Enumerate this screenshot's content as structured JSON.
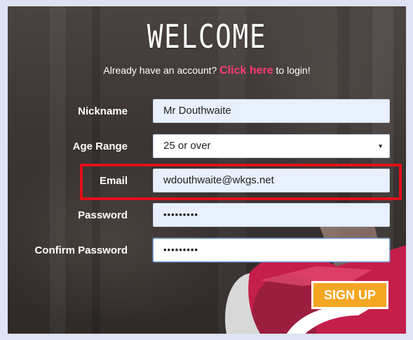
{
  "header": {
    "title": "WELCOME",
    "login_prompt": "Already have an account?",
    "login_link": "Click here",
    "login_suffix": "to login!"
  },
  "form": {
    "nickname": {
      "label": "Nickname",
      "value": "Mr Douthwaite"
    },
    "age_range": {
      "label": "Age Range",
      "value": "25 or over"
    },
    "email": {
      "label": "Email",
      "value": "wdouthwaite@wkgs.net"
    },
    "password": {
      "label": "Password",
      "value": "•••••••••"
    },
    "confirm_password": {
      "label": "Confirm Password",
      "value": "•••••••••"
    }
  },
  "actions": {
    "signup_label": "SIGN UP"
  },
  "colors": {
    "link": "#ff3b72",
    "button": "#f5a623",
    "highlight": "#e0101a"
  }
}
